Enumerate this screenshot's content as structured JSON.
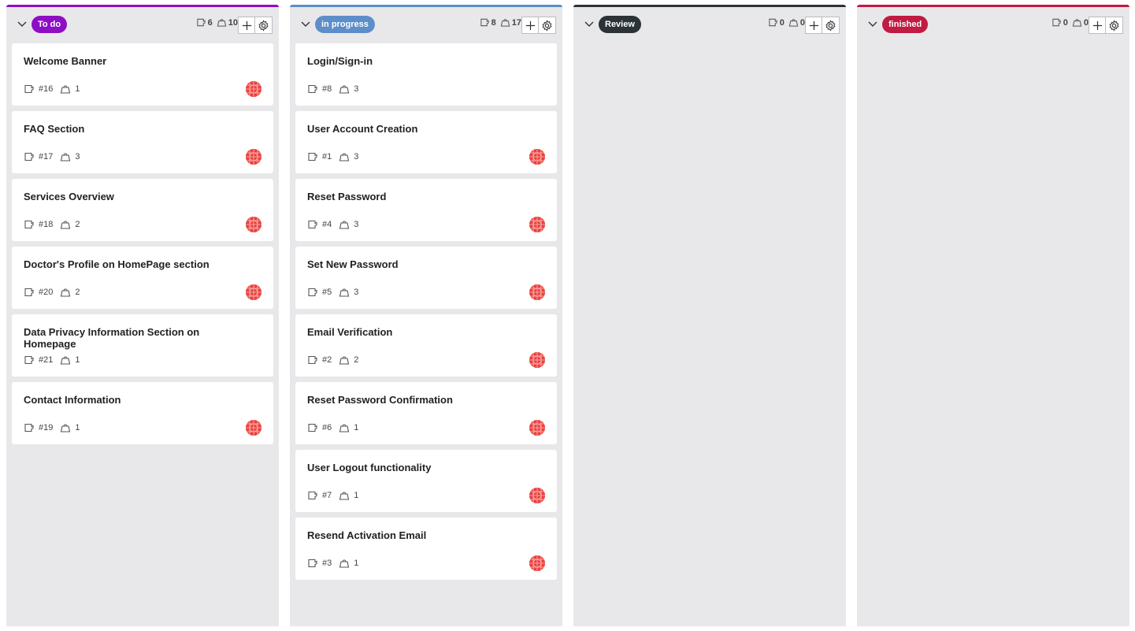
{
  "columns": [
    {
      "label": "To do",
      "color": "#8e0ec4",
      "issue_count": "6",
      "weight_count": "10",
      "cards": [
        {
          "title": "Welcome Banner",
          "id": "#16",
          "weight": "1",
          "avatar": true
        },
        {
          "title": "FAQ Section",
          "id": "#17",
          "weight": "3",
          "avatar": true
        },
        {
          "title": "Services Overview",
          "id": "#18",
          "weight": "2",
          "avatar": true
        },
        {
          "title": "Doctor's Profile on HomePage section",
          "id": "#20",
          "weight": "2",
          "avatar": true
        },
        {
          "title": "Data Privacy Information Section on Homepage",
          "id": "#21",
          "weight": "1",
          "avatar": false
        },
        {
          "title": "Contact Information",
          "id": "#19",
          "weight": "1",
          "avatar": true
        }
      ]
    },
    {
      "label": "in progress",
      "color": "#5d8ec9",
      "issue_count": "8",
      "weight_count": "17",
      "cards": [
        {
          "title": "Login/Sign-in",
          "id": "#8",
          "weight": "3",
          "avatar": false
        },
        {
          "title": "User Account Creation",
          "id": "#1",
          "weight": "3",
          "avatar": true
        },
        {
          "title": "Reset Password",
          "id": "#4",
          "weight": "3",
          "avatar": true
        },
        {
          "title": "Set New Password",
          "id": "#5",
          "weight": "3",
          "avatar": true
        },
        {
          "title": "Email Verification",
          "id": "#2",
          "weight": "2",
          "avatar": true
        },
        {
          "title": "Reset Password Confirmation",
          "id": "#6",
          "weight": "1",
          "avatar": true
        },
        {
          "title": "User Logout functionality",
          "id": "#7",
          "weight": "1",
          "avatar": true
        },
        {
          "title": "Resend Activation Email",
          "id": "#3",
          "weight": "1",
          "avatar": true
        }
      ]
    },
    {
      "label": "Review",
      "color": "#2b3337",
      "issue_count": "0",
      "weight_count": "0",
      "cards": []
    },
    {
      "label": "finished",
      "color": "#c01b42",
      "issue_count": "0",
      "weight_count": "0",
      "cards": []
    }
  ],
  "icons": {
    "chevron": "chevron-down-icon",
    "issues": "issues-icon",
    "weight": "weight-icon",
    "add": "plus-icon",
    "settings": "gear-icon",
    "avatar": "avatar"
  }
}
